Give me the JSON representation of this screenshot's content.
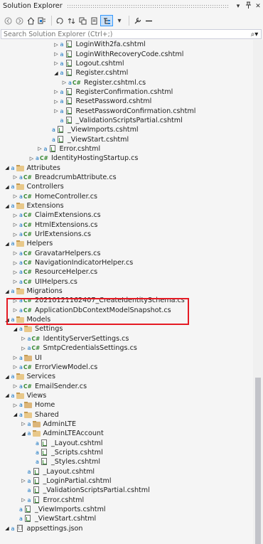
{
  "window": {
    "title": "Solution Explorer",
    "buttons": [
      "▾",
      "🖈",
      "✕"
    ]
  },
  "toolbar": {
    "icons": [
      "back-icon",
      "forward-icon",
      "home-icon",
      "switch-views-icon",
      "pending-changes-icon",
      "sync-icon",
      "collapse-all-icon",
      "show-all-files-icon",
      "preview-selected-icon",
      "properties-icon",
      "minus-icon"
    ]
  },
  "search": {
    "placeholder": "Search Solution Explorer (Ctrl+;)"
  },
  "tree": [
    {
      "depth": 7,
      "exp": "closed",
      "lock": true,
      "icon": "cshtml",
      "label": "LoginWith2fa.cshtml"
    },
    {
      "depth": 7,
      "exp": "closed",
      "lock": true,
      "icon": "cshtml",
      "label": "LoginWithRecoveryCode.cshtml"
    },
    {
      "depth": 7,
      "exp": "closed",
      "lock": true,
      "icon": "cshtml",
      "label": "Logout.cshtml"
    },
    {
      "depth": 7,
      "exp": "open",
      "lock": true,
      "icon": "cshtml",
      "label": "Register.cshtml"
    },
    {
      "depth": 8,
      "exp": "closed",
      "lock": true,
      "icon": "cs",
      "label": "Register.cshtml.cs"
    },
    {
      "depth": 7,
      "exp": "closed",
      "lock": true,
      "icon": "cshtml",
      "label": "RegisterConfirmation.cshtml"
    },
    {
      "depth": 7,
      "exp": "closed",
      "lock": true,
      "icon": "cshtml",
      "label": "ResetPassword.cshtml"
    },
    {
      "depth": 7,
      "exp": "closed",
      "lock": true,
      "icon": "cshtml",
      "label": "ResetPasswordConfirmation.cshtml"
    },
    {
      "depth": 7,
      "exp": "none",
      "lock": true,
      "icon": "cshtml",
      "label": "_ValidationScriptsPartial.cshtml"
    },
    {
      "depth": 6,
      "exp": "none",
      "lock": true,
      "icon": "cshtml",
      "label": "_ViewImports.cshtml"
    },
    {
      "depth": 6,
      "exp": "none",
      "lock": true,
      "icon": "cshtml",
      "label": "_ViewStart.cshtml"
    },
    {
      "depth": 5,
      "exp": "closed",
      "lock": true,
      "icon": "cshtml",
      "label": "Error.cshtml"
    },
    {
      "depth": 4,
      "exp": "closed",
      "lock": true,
      "icon": "cs",
      "label": "IdentityHostingStartup.cs"
    },
    {
      "depth": 1,
      "exp": "open",
      "lock": true,
      "icon": "folder-open",
      "label": "Attributes"
    },
    {
      "depth": 2,
      "exp": "closed",
      "lock": true,
      "icon": "cs",
      "label": "BreadcrumbAttribute.cs"
    },
    {
      "depth": 1,
      "exp": "open",
      "lock": true,
      "icon": "folder-open",
      "label": "Controllers"
    },
    {
      "depth": 2,
      "exp": "closed",
      "lock": true,
      "icon": "cs",
      "label": "HomeController.cs"
    },
    {
      "depth": 1,
      "exp": "open",
      "lock": true,
      "icon": "folder-open",
      "label": "Extensions"
    },
    {
      "depth": 2,
      "exp": "closed",
      "lock": true,
      "icon": "cs",
      "label": "ClaimExtensions.cs"
    },
    {
      "depth": 2,
      "exp": "closed",
      "lock": true,
      "icon": "cs",
      "label": "HtmlExtensions.cs"
    },
    {
      "depth": 2,
      "exp": "closed",
      "lock": true,
      "icon": "cs",
      "label": "UrlExtensions.cs"
    },
    {
      "depth": 1,
      "exp": "open",
      "lock": true,
      "icon": "folder-open",
      "label": "Helpers"
    },
    {
      "depth": 2,
      "exp": "closed",
      "lock": true,
      "icon": "cs",
      "label": "GravatarHelpers.cs"
    },
    {
      "depth": 2,
      "exp": "closed",
      "lock": true,
      "icon": "cs",
      "label": "NavigationIndicatorHelper.cs"
    },
    {
      "depth": 2,
      "exp": "closed",
      "lock": true,
      "icon": "cs",
      "label": "ResourceHelper.cs"
    },
    {
      "depth": 2,
      "exp": "closed",
      "lock": true,
      "icon": "cs",
      "label": "UIHelpers.cs"
    },
    {
      "depth": 1,
      "exp": "open",
      "lock": true,
      "icon": "folder-open",
      "label": "Migrations"
    },
    {
      "depth": 2,
      "exp": "closed",
      "lock": true,
      "icon": "cs",
      "label": "20210121162407_CreateIdentitySchema.cs"
    },
    {
      "depth": 2,
      "exp": "closed",
      "lock": true,
      "icon": "cs",
      "label": "ApplicationDbContextModelSnapshot.cs"
    },
    {
      "depth": 1,
      "exp": "open",
      "lock": true,
      "icon": "folder-open",
      "label": "Models"
    },
    {
      "depth": 2,
      "exp": "open",
      "lock": true,
      "icon": "folder-open",
      "label": "Settings"
    },
    {
      "depth": 3,
      "exp": "closed",
      "lock": true,
      "icon": "cs",
      "label": "IdentityServerSettings.cs"
    },
    {
      "depth": 3,
      "exp": "closed",
      "lock": true,
      "icon": "cs",
      "label": "SmtpCredentialsSettings.cs"
    },
    {
      "depth": 2,
      "exp": "closed",
      "lock": true,
      "icon": "folder",
      "label": "UI"
    },
    {
      "depth": 2,
      "exp": "closed",
      "lock": true,
      "icon": "cs",
      "label": "ErrorViewModel.cs"
    },
    {
      "depth": 1,
      "exp": "open",
      "lock": true,
      "icon": "folder-open",
      "label": "Services"
    },
    {
      "depth": 2,
      "exp": "closed",
      "lock": true,
      "icon": "cs",
      "label": "EmailSender.cs"
    },
    {
      "depth": 1,
      "exp": "open",
      "lock": true,
      "icon": "folder-open",
      "label": "Views"
    },
    {
      "depth": 2,
      "exp": "closed",
      "lock": true,
      "icon": "folder",
      "label": "Home"
    },
    {
      "depth": 2,
      "exp": "open",
      "lock": true,
      "icon": "folder-open",
      "label": "Shared"
    },
    {
      "depth": 3,
      "exp": "closed",
      "lock": true,
      "icon": "folder",
      "label": "AdminLTE"
    },
    {
      "depth": 3,
      "exp": "open",
      "lock": true,
      "icon": "folder-open",
      "label": "AdminLTEAccount"
    },
    {
      "depth": 4,
      "exp": "none",
      "lock": true,
      "icon": "cshtml",
      "label": "_Layout.cshtml"
    },
    {
      "depth": 4,
      "exp": "none",
      "lock": true,
      "icon": "cshtml",
      "label": "_Scripts.cshtml"
    },
    {
      "depth": 4,
      "exp": "none",
      "lock": true,
      "icon": "cshtml",
      "label": "_Styles.cshtml"
    },
    {
      "depth": 3,
      "exp": "none",
      "lock": true,
      "icon": "cshtml",
      "label": "_Layout.cshtml"
    },
    {
      "depth": 3,
      "exp": "closed",
      "lock": true,
      "icon": "cshtml",
      "label": "_LoginPartial.cshtml"
    },
    {
      "depth": 3,
      "exp": "none",
      "lock": true,
      "icon": "cshtml",
      "label": "_ValidationScriptsPartial.cshtml"
    },
    {
      "depth": 3,
      "exp": "closed",
      "lock": true,
      "icon": "cshtml",
      "label": "Error.cshtml"
    },
    {
      "depth": 2,
      "exp": "none",
      "lock": true,
      "icon": "cshtml",
      "label": "_ViewImports.cshtml"
    },
    {
      "depth": 2,
      "exp": "none",
      "lock": true,
      "icon": "cshtml",
      "label": "_ViewStart.cshtml"
    },
    {
      "depth": 1,
      "exp": "open",
      "lock": true,
      "icon": "json",
      "label": "appsettings.json"
    }
  ],
  "colors": {
    "highlight_border": "#e51a24",
    "cs_icon": "#368832",
    "folder": "#dcb67a",
    "lock": "#0e70c0"
  }
}
